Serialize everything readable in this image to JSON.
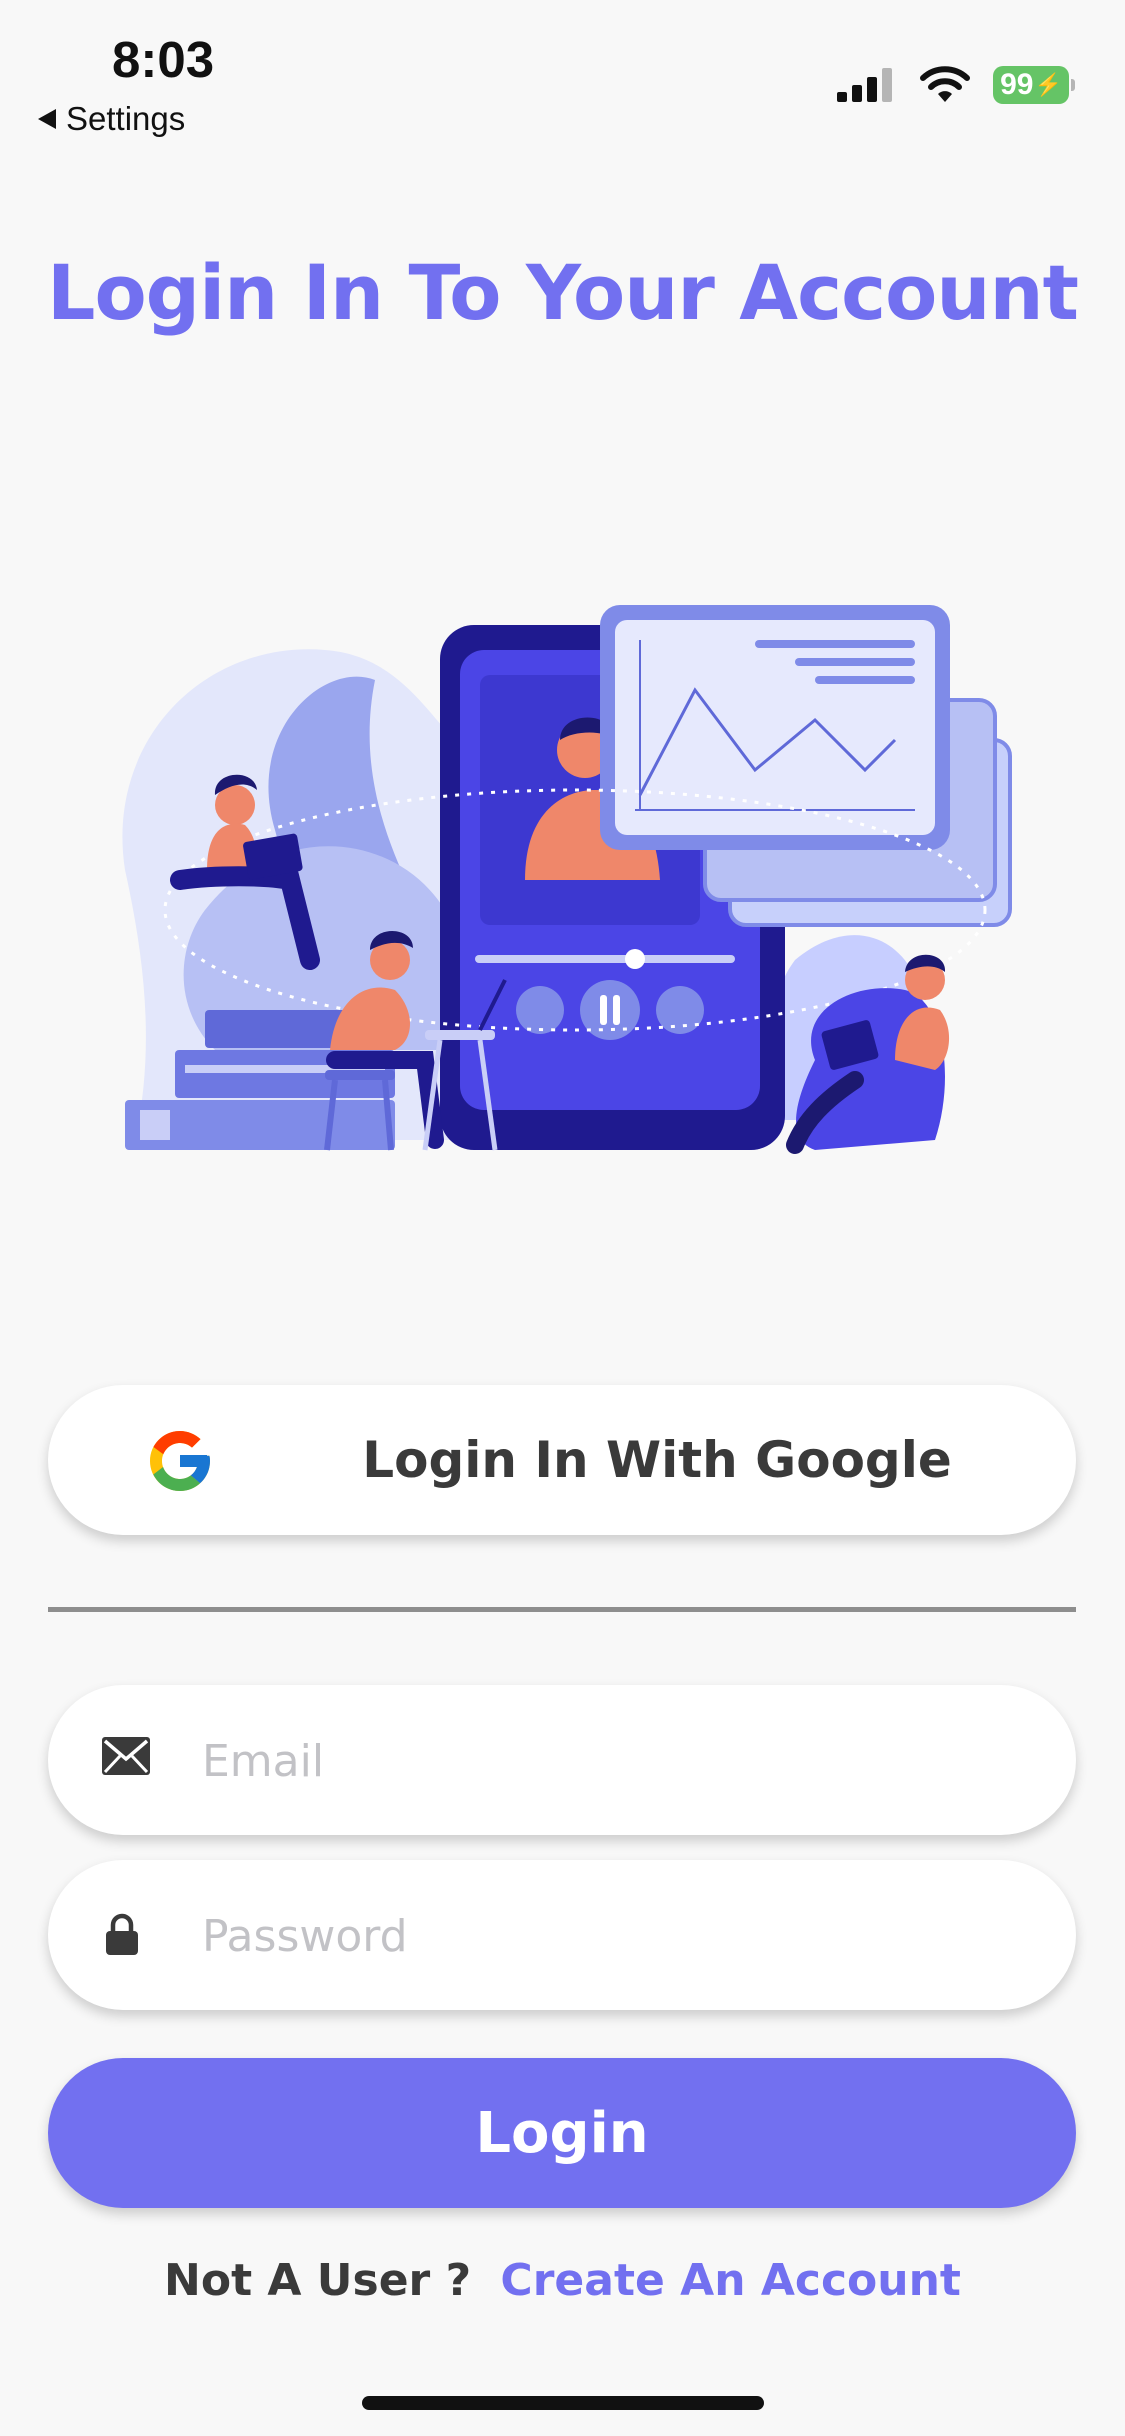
{
  "status_bar": {
    "time": "8:03",
    "back_label": "Settings",
    "battery": "99"
  },
  "title": "Login In To Your Account",
  "google_button": {
    "label": "Login In With Google",
    "icon": "google-g-icon"
  },
  "email": {
    "placeholder": "Email",
    "value": "",
    "icon": "envelope-icon"
  },
  "password": {
    "placeholder": "Password",
    "value": "",
    "icon": "lock-icon"
  },
  "login_button": {
    "label": "Login"
  },
  "signup": {
    "prompt": "Not A User ?",
    "link": "Create An Account"
  },
  "colors": {
    "accent": "#7270f0",
    "background": "#f8f8f8",
    "battery": "#65c466"
  }
}
